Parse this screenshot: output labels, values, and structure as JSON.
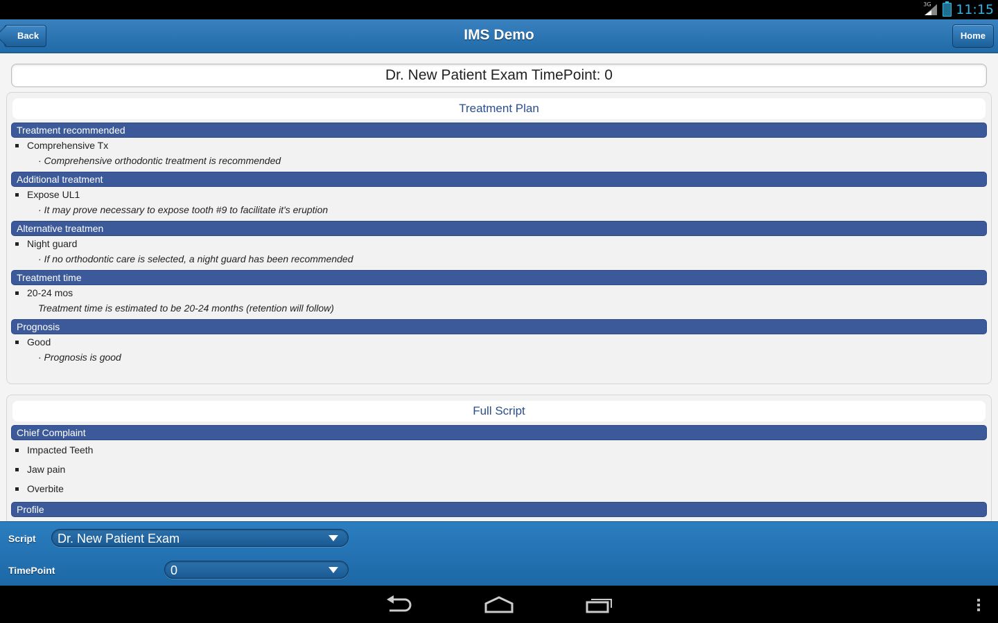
{
  "status_bar": {
    "network": "3G",
    "time": "11:15"
  },
  "header": {
    "title": "IMS Demo",
    "back_label": "Back",
    "home_label": "Home"
  },
  "page_title": "Dr. New Patient Exam TimePoint: 0",
  "treatment_plan": {
    "heading": "Treatment Plan",
    "sections": [
      {
        "label": "Treatment recommended",
        "item": "Comprehensive Tx",
        "note": "· Comprehensive orthodontic treatment is recommended"
      },
      {
        "label": "Additional treatment",
        "item": "Expose UL1",
        "note": "· It may prove necessary to expose tooth #9 to facilitate it's eruption"
      },
      {
        "label": "Alternative treatmen",
        "item": "Night guard",
        "note": "· If no orthodontic care is selected, a night guard has been recommended"
      },
      {
        "label": "Treatment time",
        "item": "20-24 mos",
        "note": "Treatment time is estimated to be 20-24 months (retention will follow)"
      },
      {
        "label": "Prognosis",
        "item": "Good",
        "note": "· Prognosis is good"
      }
    ]
  },
  "full_script": {
    "heading": "Full Script",
    "chief_complaint": {
      "label": "Chief Complaint",
      "items": [
        "Impacted Teeth",
        "Jaw pain",
        "Overbite"
      ]
    },
    "profile": {
      "label": "Profile"
    }
  },
  "controls": {
    "script_label": "Script",
    "script_value": "Dr. New Patient Exam",
    "timepoint_label": "TimePoint",
    "timepoint_value": "0"
  },
  "colors": {
    "header": "#2b7ec0",
    "section_bar": "#3c5a9a",
    "panel_heading": "#2a4d8f"
  },
  "nav_icons": [
    "back-icon",
    "home-icon",
    "recent-apps-icon",
    "overflow-menu-icon"
  ]
}
